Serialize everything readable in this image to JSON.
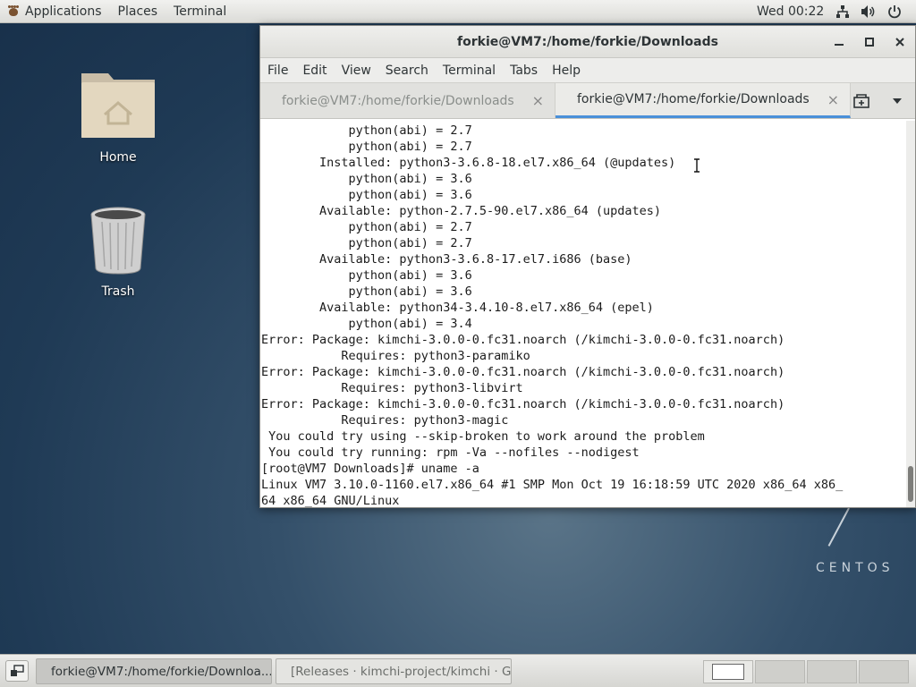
{
  "topbar": {
    "applications": "Applications",
    "places": "Places",
    "terminal": "Terminal",
    "clock": "Wed 00:22",
    "icons": [
      "network-icon",
      "volume-icon",
      "power-icon"
    ]
  },
  "desktop": {
    "icons": [
      {
        "label": "Home",
        "icon": "home-folder-icon"
      },
      {
        "label": "Trash",
        "icon": "trash-icon"
      }
    ],
    "brand": "CENTOS"
  },
  "window": {
    "title": "forkie@VM7:/home/forkie/Downloads",
    "menu": [
      "File",
      "Edit",
      "View",
      "Search",
      "Terminal",
      "Tabs",
      "Help"
    ],
    "tabs": [
      {
        "label": "forkie@VM7:/home/forkie/Downloads",
        "active": false
      },
      {
        "label": "forkie@VM7:/home/forkie/Downloads",
        "active": true
      }
    ],
    "terminal_lines": [
      "            python(abi) = 2.7",
      "            python(abi) = 2.7",
      "        Installed: python3-3.6.8-18.el7.x86_64 (@updates)",
      "            python(abi) = 3.6",
      "            python(abi) = 3.6",
      "        Available: python-2.7.5-90.el7.x86_64 (updates)",
      "            python(abi) = 2.7",
      "            python(abi) = 2.7",
      "        Available: python3-3.6.8-17.el7.i686 (base)",
      "            python(abi) = 3.6",
      "            python(abi) = 3.6",
      "        Available: python34-3.4.10-8.el7.x86_64 (epel)",
      "            python(abi) = 3.4",
      "Error: Package: kimchi-3.0.0-0.fc31.noarch (/kimchi-3.0.0-0.fc31.noarch)",
      "           Requires: python3-paramiko",
      "Error: Package: kimchi-3.0.0-0.fc31.noarch (/kimchi-3.0.0-0.fc31.noarch)",
      "           Requires: python3-libvirt",
      "Error: Package: kimchi-3.0.0-0.fc31.noarch (/kimchi-3.0.0-0.fc31.noarch)",
      "           Requires: python3-magic",
      " You could try using --skip-broken to work around the problem",
      " You could try running: rpm -Va --nofiles --nodigest",
      "[root@VM7 Downloads]# uname -a",
      "Linux VM7 3.10.0-1160.el7.x86_64 #1 SMP Mon Oct 19 16:18:59 UTC 2020 x86_64 x86_",
      "64 x86_64 GNU/Linux"
    ]
  },
  "taskbar": {
    "tasks": [
      {
        "label": "forkie@VM7:/home/forkie/Downloa...",
        "active": true
      },
      {
        "label": "[Releases · kimchi-project/kimchi · G...",
        "active": false
      }
    ]
  }
}
